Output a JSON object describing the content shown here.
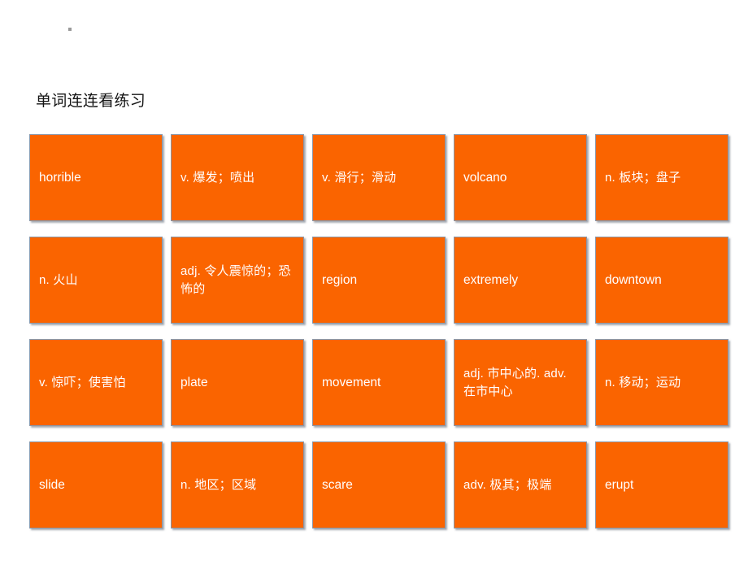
{
  "slide": {
    "title": "单词连连看练习",
    "corner_mark": ".",
    "card_color": "#fa6400",
    "card_text_color": "#ffffff",
    "background": "#ffffff"
  },
  "cards": [
    {
      "text": "horrible",
      "lang": "en"
    },
    {
      "text": "v. 爆发；喷出",
      "lang": "cn"
    },
    {
      "text": "v. 滑行；滑动",
      "lang": "cn"
    },
    {
      "text": "volcano",
      "lang": "en"
    },
    {
      "text": "n. 板块；盘子",
      "lang": "cn"
    },
    {
      "text": "n. 火山",
      "lang": "cn"
    },
    {
      "text": "adj. 令人震惊的；恐怖的",
      "lang": "cn"
    },
    {
      "text": "region",
      "lang": "en"
    },
    {
      "text": "extremely",
      "lang": "en"
    },
    {
      "text": "downtown",
      "lang": "en"
    },
    {
      "text": "v. 惊吓；使害怕",
      "lang": "cn"
    },
    {
      "text": "plate",
      "lang": "en"
    },
    {
      "text": "movement",
      "lang": "en"
    },
    {
      "text": "adj. 市中心的. adv. 在市中心",
      "lang": "cn"
    },
    {
      "text": "n. 移动；运动",
      "lang": "cn"
    },
    {
      "text": "slide",
      "lang": "en"
    },
    {
      "text": "n. 地区；区域",
      "lang": "cn"
    },
    {
      "text": "scare",
      "lang": "en"
    },
    {
      "text": "adv. 极其；极端",
      "lang": "cn"
    },
    {
      "text": "erupt",
      "lang": "en"
    }
  ]
}
